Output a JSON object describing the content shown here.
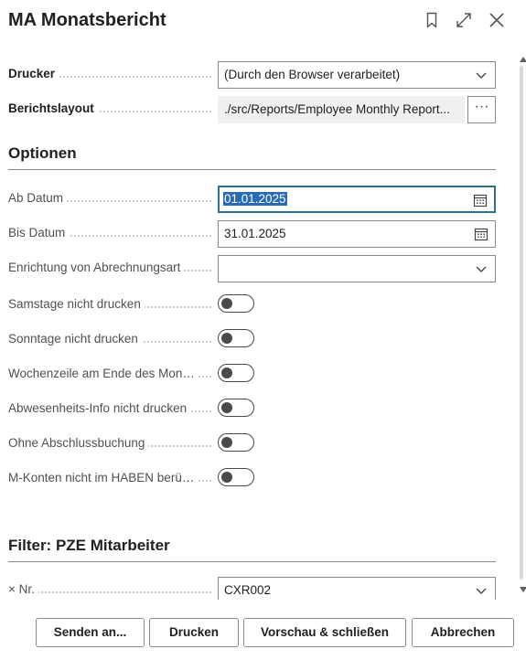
{
  "dialog": {
    "title": "MA Monatsbericht",
    "icons": [
      "bookmark-icon",
      "expand-icon",
      "close-icon"
    ]
  },
  "printer": {
    "label": "Drucker",
    "value": "(Durch den Browser verarbeitet)"
  },
  "layout": {
    "label": "Berichtslayout",
    "value": "./src/Reports/Employee Monthly Report...",
    "more": "···"
  },
  "options": {
    "heading": "Optionen",
    "ab_datum": {
      "label": "Ab Datum",
      "value": "01.01.2025"
    },
    "bis_datum": {
      "label": "Bis Datum",
      "value": "31.01.2025"
    },
    "abrechnungsart": {
      "label": "Enrichtung von Abrechnungsart",
      "value": ""
    },
    "toggles": [
      {
        "label": "Samstage nicht drucken",
        "on": false
      },
      {
        "label": "Sonntage nicht drucken",
        "on": false
      },
      {
        "label": "Wochenzeile am Ende des Mon…",
        "on": false
      },
      {
        "label": "Abwesenheits-Info nicht drucken",
        "on": false
      },
      {
        "label": "Ohne Abschlussbuchung",
        "on": false
      },
      {
        "label": "M-Konten nicht im HABEN berü…",
        "on": false
      }
    ]
  },
  "filter": {
    "heading": "Filter: PZE Mitarbeiter",
    "nr_remove": "×",
    "nr_label": "Nr.",
    "nr_value": "CXR002"
  },
  "footer": {
    "send": "Senden an...",
    "print": "Drucken",
    "preview": "Vorschau & schließen",
    "cancel": "Abbrechen"
  }
}
